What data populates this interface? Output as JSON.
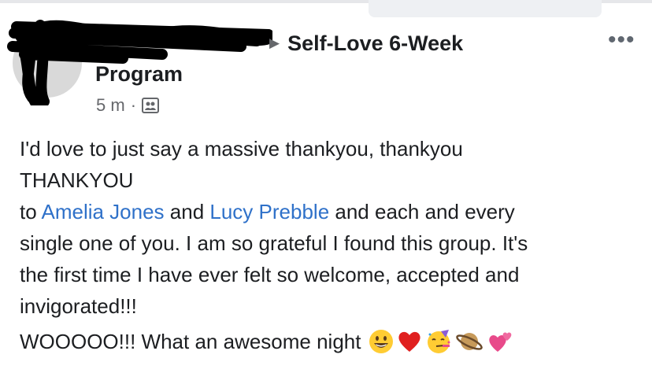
{
  "group": {
    "arrow_icon": "triangle-right-icon",
    "name_line1": "Self-Love 6-Week",
    "name_line2": "Program"
  },
  "post": {
    "time": "5 m",
    "separator": "·",
    "audience_icon": "group-audience-icon",
    "more_label": "•••",
    "text": {
      "line1": "I'd love to just say a massive thankyou, thankyou",
      "line2": "THANKYOU",
      "to": "to ",
      "mention1": "Amelia Jones",
      "and": " and ",
      "mention2": "Lucy Prebble",
      "rest1": " and each and every",
      "line4": "single one of you. I am so grateful I found this group. It's",
      "line5": "the first time I have ever felt so welcome, accepted and",
      "line6": "invigorated!!!",
      "line7": "WOOOOO!!! What an awesome night"
    },
    "emojis": [
      "grinning-face-icon",
      "red-heart-icon",
      "partying-face-icon",
      "ringed-planet-icon",
      "two-hearts-icon"
    ]
  },
  "colors": {
    "mention": "#2f71c9",
    "meta": "#65676b",
    "text": "#1c1e21"
  }
}
